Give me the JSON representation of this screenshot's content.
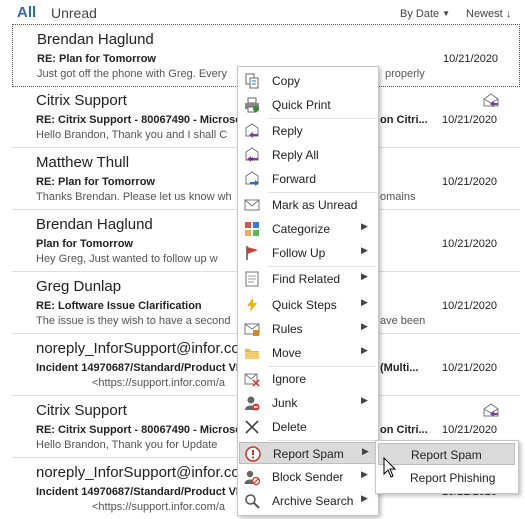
{
  "header": {
    "tab_all": "All",
    "tab_unread": "Unread",
    "sort_by": "By Date",
    "sort_order": "Newest"
  },
  "messages": [
    {
      "sender": "Brendan Haglund",
      "subject": "RE: Plan for Tomorrow",
      "preview": "Just got off the phone with Greg. Every",
      "preview_tail": "properly",
      "date": "10/21/2020",
      "icon": "none"
    },
    {
      "sender": "Citrix Support",
      "subject": "RE: Citrix Support - 80067490 - Microsof",
      "subject_tail": "on Citri...",
      "preview": "Hello Brandon,  Thank you and I shall C",
      "date": "10/21/2020",
      "icon": "replied-envelope-icon"
    },
    {
      "sender": "Matthew Thull",
      "subject": "RE: Plan for Tomorrow",
      "preview": "Thanks Brendan. Please let us know wh",
      "preview_tail": "omains",
      "date": "10/21/2020",
      "icon": "none"
    },
    {
      "sender": "Brendan Haglund",
      "subject": "Plan for Tomorrow",
      "preview": "Hey Greg,  Just wanted to follow up w",
      "date": "10/21/2020",
      "icon": "none"
    },
    {
      "sender": "Greg Dunlap",
      "subject": "RE: Loftware Issue Clarification",
      "preview": "The issue is they wish to have a second",
      "preview_tail": "ave been",
      "date": "10/21/2020",
      "icon": "none"
    },
    {
      "sender": "noreply_InforSupport@infor.co",
      "subject": "Incident 14970687/Standard/Product VE",
      "subject_tail": "(Multi...",
      "preview": "<https://support.infor.com/a",
      "date": "10/21/2020",
      "icon": "none"
    },
    {
      "sender": "Citrix Support",
      "subject": "RE: Citrix Support - 80067490 - Microsof",
      "subject_tail": "on Citri...",
      "preview": "Hello Brandon,  Thank you for Update",
      "date": "10/21/2020",
      "icon": "replied-envelope-icon"
    },
    {
      "sender": "noreply_InforSupport@infor.co",
      "subject": "Incident 14970687/Standard/Product VE",
      "subject_tail": "(Multi...",
      "preview": "<https://support.infor.com/a",
      "date": "10/21/2020",
      "icon": "none"
    }
  ],
  "context_menu": {
    "items": [
      {
        "label": "Copy",
        "icon": "copy-icon",
        "submenu": false
      },
      {
        "label": "Quick Print",
        "icon": "quick-print-icon",
        "submenu": false
      },
      {
        "label": "Reply",
        "icon": "reply-icon",
        "submenu": false
      },
      {
        "label": "Reply All",
        "icon": "reply-all-icon",
        "submenu": false
      },
      {
        "label": "Forward",
        "icon": "forward-icon",
        "submenu": false
      },
      {
        "label": "Mark as Unread",
        "icon": "mark-unread-icon",
        "submenu": false
      },
      {
        "label": "Categorize",
        "icon": "categorize-icon",
        "submenu": true
      },
      {
        "label": "Follow Up",
        "icon": "follow-up-flag-icon",
        "submenu": true
      },
      {
        "label": "Find Related",
        "icon": "find-related-icon",
        "submenu": true
      },
      {
        "label": "Quick Steps",
        "icon": "quick-steps-icon",
        "submenu": true
      },
      {
        "label": "Rules",
        "icon": "rules-icon",
        "submenu": true
      },
      {
        "label": "Move",
        "icon": "move-folder-icon",
        "submenu": true
      },
      {
        "label": "Ignore",
        "icon": "ignore-icon",
        "submenu": false
      },
      {
        "label": "Junk",
        "icon": "junk-icon",
        "submenu": true
      },
      {
        "label": "Delete",
        "icon": "delete-icon",
        "submenu": false
      },
      {
        "label": "Report Spam",
        "icon": "report-spam-icon",
        "submenu": true,
        "highlighted": true
      },
      {
        "label": "Block Sender",
        "icon": "block-sender-icon",
        "submenu": true
      },
      {
        "label": "Archive Search",
        "icon": "archive-search-icon",
        "submenu": true
      }
    ]
  },
  "submenu": {
    "items": [
      {
        "label": "Report Spam",
        "highlighted": true
      },
      {
        "label": "Report Phishing"
      }
    ]
  },
  "colors": {
    "accent": "#2b6cb0",
    "highlight": "#dadada"
  }
}
